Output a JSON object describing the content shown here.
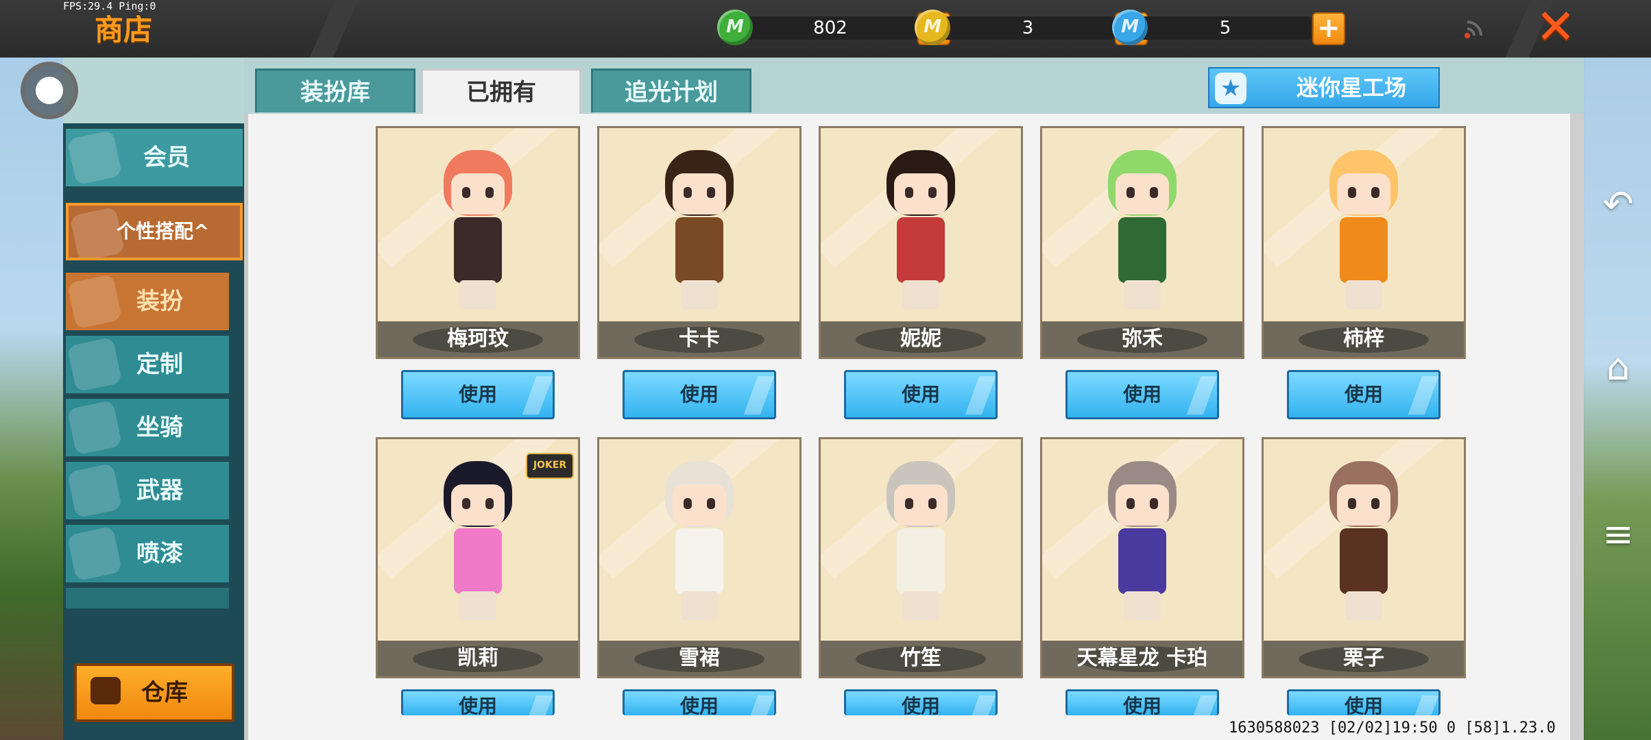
{
  "hud": {
    "fps": "FPS:29.4  Ping:0"
  },
  "header": {
    "title": "商店",
    "currencies": [
      {
        "icon": "green-gem-coin-icon",
        "color": "#3fae3b",
        "letter": "M",
        "value": "802"
      },
      {
        "icon": "gold-coin-icon",
        "color": "#e6b81f",
        "letter": "M",
        "value": "3"
      },
      {
        "icon": "blue-coin-icon",
        "color": "#39a6e8",
        "letter": "M",
        "value": "5"
      }
    ]
  },
  "sidebar": {
    "items": [
      {
        "label": "会员"
      },
      {
        "label": "个性搭配^"
      },
      {
        "label": "装扮"
      },
      {
        "label": "定制"
      },
      {
        "label": "坐骑"
      },
      {
        "label": "武器"
      },
      {
        "label": "喷漆"
      }
    ],
    "warehouse_label": "仓库"
  },
  "tabs": [
    {
      "label": "装扮库"
    },
    {
      "label": "已拥有"
    },
    {
      "label": "追光计划"
    }
  ],
  "workshop_label": "迷你星工场",
  "use_label": "使用",
  "cards": [
    {
      "name": "梅珂玟",
      "hair": "#f07a5e",
      "outfit": "#3a2a2a"
    },
    {
      "name": "卡卡",
      "hair": "#3a2418",
      "outfit": "#7a4a24"
    },
    {
      "name": "妮妮",
      "hair": "#2a1a14",
      "outfit": "#c53a3a"
    },
    {
      "name": "弥禾",
      "hair": "#8fd86a",
      "outfit": "#2f6a34"
    },
    {
      "name": "柿梓",
      "hair": "#ffc46a",
      "outfit": "#f08a1a"
    },
    {
      "name": "凯莉",
      "hair": "#1a1a2a",
      "outfit": "#f07ac8",
      "badge": "JOKER"
    },
    {
      "name": "雪裙",
      "hair": "#e8e2d6",
      "outfit": "#f6f3ec"
    },
    {
      "name": "竹笙",
      "hair": "#c9c4bc",
      "outfit": "#f3efe2"
    },
    {
      "name": "天幕星龙 卡珀",
      "hair": "#9a8a86",
      "outfit": "#4a3aa0"
    },
    {
      "name": "栗子",
      "hair": "#9a7060",
      "outfit": "#5a3222"
    }
  ],
  "footer": "1630588023  [02/02]19:50 0 [58]1.23.0"
}
